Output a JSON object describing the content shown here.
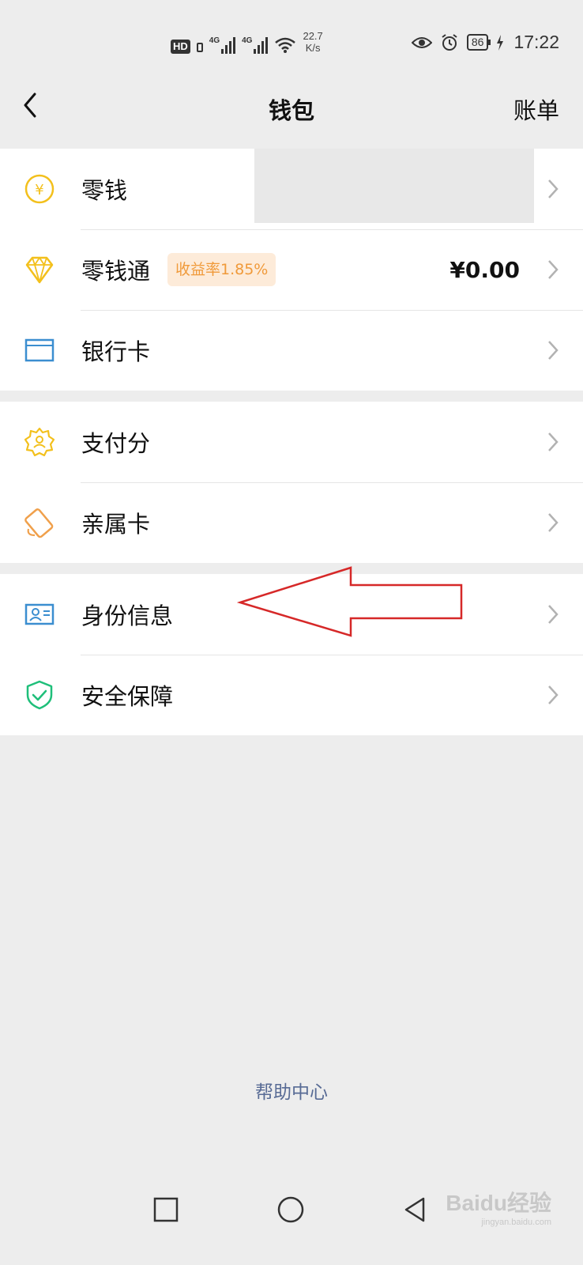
{
  "status_bar": {
    "hd": "HD",
    "sig1_tag": "4G",
    "sig2_tag": "4G",
    "speed_value": "22.7",
    "speed_unit": "K/s",
    "battery": "86",
    "time": "17:22"
  },
  "nav": {
    "title": "钱包",
    "right_link": "账单"
  },
  "groups": {
    "g1": [
      {
        "label": "零钱",
        "icon": "yuan-coin-icon"
      },
      {
        "label": "零钱通",
        "icon": "diamond-icon",
        "badge": "收益率1.85%",
        "amount": "¥0.00"
      },
      {
        "label": "银行卡",
        "icon": "bank-card-icon"
      }
    ],
    "g2": [
      {
        "label": "支付分",
        "icon": "pay-score-badge-icon"
      },
      {
        "label": "亲属卡",
        "icon": "family-card-icon"
      }
    ],
    "g3": [
      {
        "label": "身份信息",
        "icon": "id-card-icon"
      },
      {
        "label": "安全保障",
        "icon": "shield-check-icon"
      }
    ]
  },
  "help_link": "帮助中心",
  "watermark": {
    "brand": "Baidu经验",
    "url": "jingyan.baidu.com"
  },
  "colors": {
    "accent_yellow": "#f3c01c",
    "badge_bg": "#fdebd9",
    "badge_text": "#f09a3a",
    "link_blue": "#586b95",
    "annotation_red": "#d62828"
  }
}
